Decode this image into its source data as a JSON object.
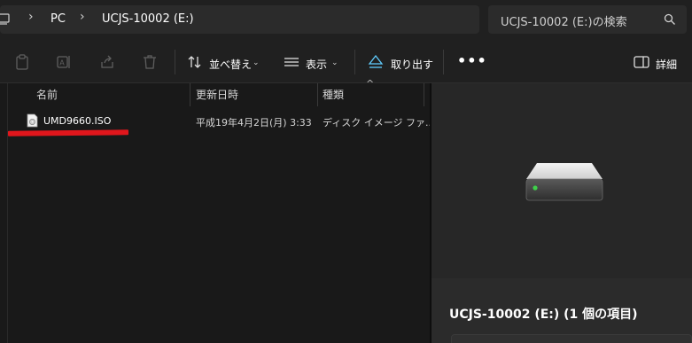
{
  "address": {
    "breadcrumbs": [
      "PC",
      "UCJS-10002 (E:)"
    ],
    "search_placeholder": "UCJS-10002 (E:)の検索"
  },
  "toolbar": {
    "sort_label": "並べ替え",
    "view_label": "表示",
    "eject_label": "取り出す",
    "more_label": "•••",
    "details_label": "詳細"
  },
  "columns": [
    "名前",
    "更新日時",
    "種類"
  ],
  "files": [
    {
      "name": "UMD9660.ISO",
      "modified": "平成19年4月2日(月) 3:33",
      "type": "ディスク イメージ ファ..."
    }
  ],
  "details_pane": {
    "title": "UCJS-10002 (E:) (1 個の項目)"
  },
  "colors": {
    "background": "#191919",
    "chrome": "#202020",
    "annotation_red": "#e0161c",
    "drive_led": "#3ed04a"
  },
  "icons": [
    "pc-icon",
    "search-icon",
    "paste-icon",
    "rename-icon",
    "share-icon",
    "delete-icon",
    "sort-icon",
    "view-icon",
    "eject-icon",
    "details-pane-icon",
    "disc-image-file-icon",
    "drive-icon"
  ]
}
